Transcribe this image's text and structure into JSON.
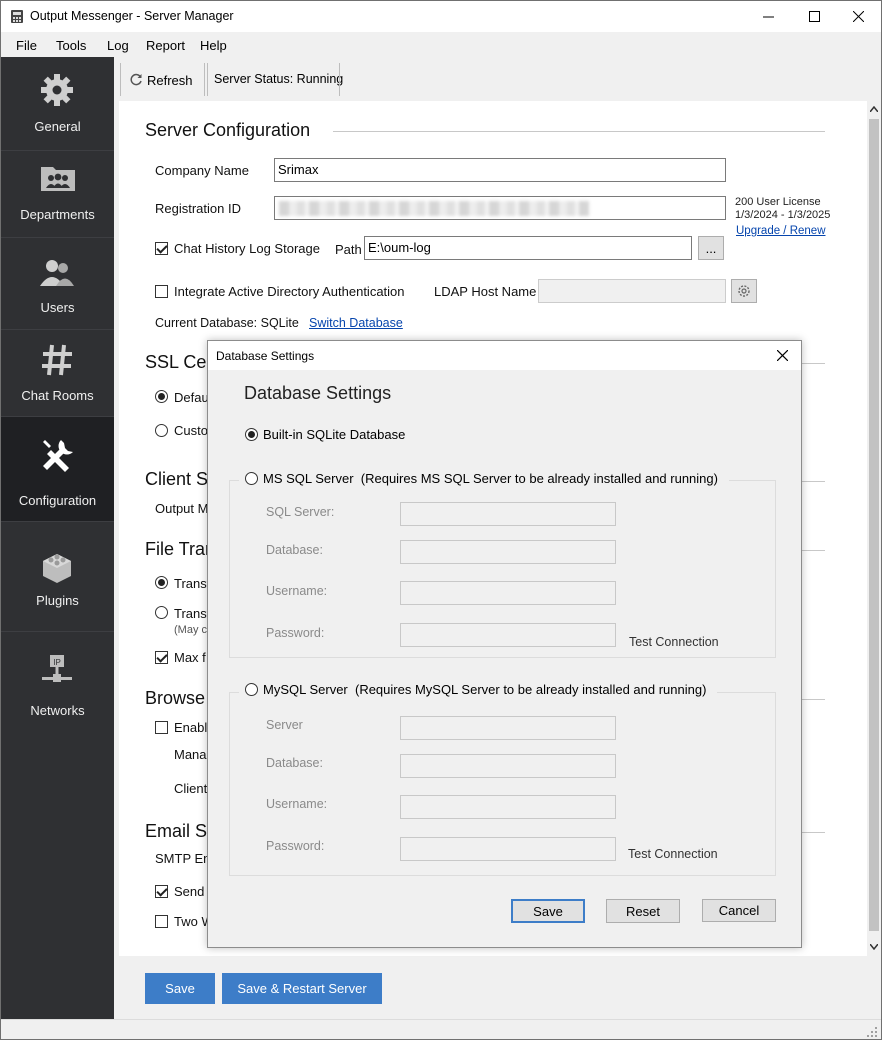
{
  "window": {
    "title": "Output Messenger - Server Manager",
    "minimize": "—",
    "maximize": "☐",
    "close": "✕"
  },
  "menu": [
    "File",
    "Tools",
    "Log",
    "Report",
    "Help"
  ],
  "sidebar": {
    "items": [
      {
        "label": "General",
        "icon": "gear-icon"
      },
      {
        "label": "Departments",
        "icon": "departments-icon"
      },
      {
        "label": "Users",
        "icon": "users-icon"
      },
      {
        "label": "Chat Rooms",
        "icon": "hash-icon"
      },
      {
        "label": "Configuration",
        "icon": "tools-icon"
      },
      {
        "label": "Plugins",
        "icon": "plugins-icon"
      },
      {
        "label": "Networks",
        "icon": "network-icon"
      }
    ],
    "active": "Configuration"
  },
  "toolbar": {
    "refresh_label": "Refresh",
    "server_status": "Server Status: Running"
  },
  "server_config": {
    "title": "Server Configuration",
    "company_name_label": "Company Name",
    "company_name_value": "Srimax",
    "registration_id_label": "Registration ID",
    "license_text": "200 User License",
    "license_dates": "1/3/2024 - 1/3/2025",
    "upgrade_link": "Upgrade / Renew",
    "chat_history_label": "Chat History Log Storage",
    "chat_history_checked": true,
    "path_label": "Path",
    "path_value": "E:\\oum-log",
    "browse_label": "...",
    "ad_auth_label": "Integrate Active Directory Authentication",
    "ad_auth_checked": false,
    "ldap_label": "LDAP Host Name",
    "current_db_label": "Current Database: SQLite",
    "switch_db_link": "Switch Database"
  },
  "partial_sections": {
    "ssl_title": "SSL Cer",
    "ssl_opt1": "Defau",
    "ssl_opt2": "Custo",
    "client_title": "Client S",
    "client_text": "Output M",
    "file_title": "File Trar",
    "file_opt1": "Transf",
    "file_opt2": "Transf",
    "file_note": "(May co",
    "file_max": "Max f",
    "browser_title": "Browse",
    "browser_enable": "Enabl",
    "browser_mana": "Mana",
    "browser_client": "Client",
    "email_title": "Email S",
    "email_smtp": "SMTP Em",
    "email_send": "Send",
    "email_two": "Two W"
  },
  "bottom": {
    "save": "Save",
    "save_restart": "Save & Restart Server"
  },
  "dialog": {
    "window_title": "Database Settings",
    "heading": "Database Settings",
    "close": "✕",
    "builtin_label": "Built-in SQLite Database",
    "builtin_selected": true,
    "mssql": {
      "label": "MS SQL Server  (Requires MS SQL Server to be already installed and running)",
      "fields": [
        "SQL Server:",
        "Database:",
        "Username:",
        "Password:"
      ],
      "test": "Test Connection"
    },
    "mysql": {
      "label": "MySQL Server  (Requires MySQL Server to be already installed and running)",
      "fields": [
        "Server",
        "Database:",
        "Username:",
        "Password:"
      ],
      "test": "Test Connection"
    },
    "save": "Save",
    "reset": "Reset",
    "cancel": "Cancel"
  },
  "colors": {
    "sidebar_bg": "#2f3033",
    "accent_blue": "#3d7dc8",
    "link": "#0645ad"
  }
}
